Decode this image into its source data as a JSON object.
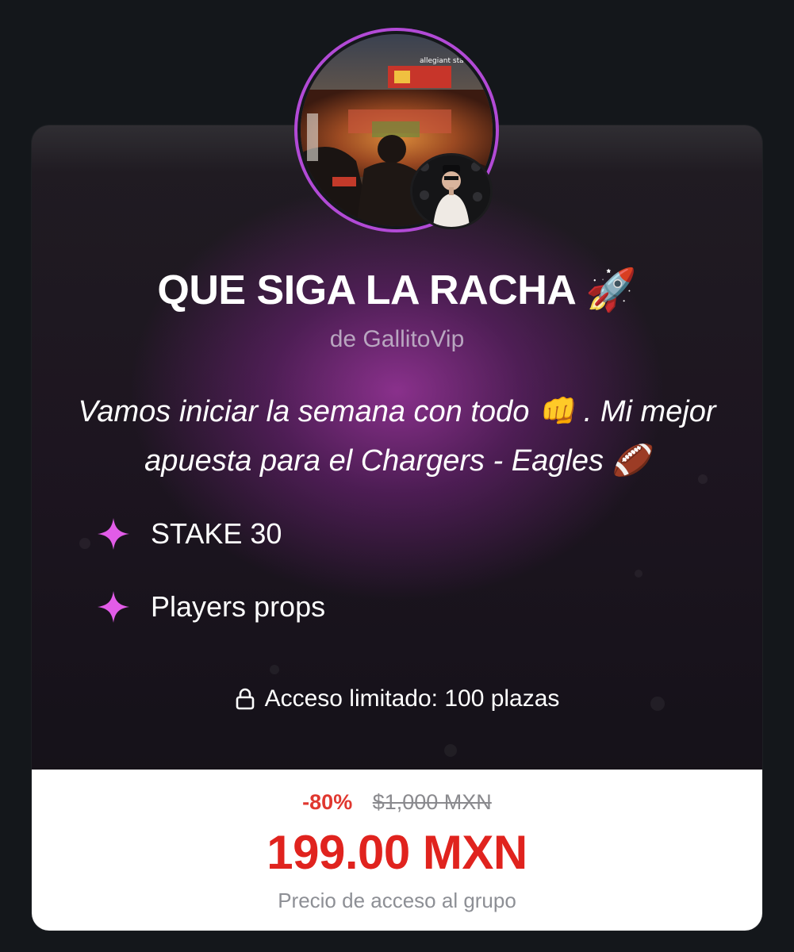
{
  "group": {
    "title": "QUE SIGA LA RACHA 🚀",
    "author": "de GallitoVip",
    "description": "Vamos iniciar la semana con todo 👊 . Mi mejor apuesta para el Chargers - Eagles 🏈",
    "features": [
      {
        "label": "STAKE 30",
        "icon": "sparkle-icon"
      },
      {
        "label": "Players props",
        "icon": "sparkle-icon"
      }
    ],
    "access": "Acceso limitado: 100 plazas"
  },
  "pricing": {
    "discount": "-80%",
    "original_price": "$1,000 MXN",
    "price": "199.00 MXN",
    "caption": "Precio de acceso al grupo"
  },
  "avatar": {
    "stadium_sign": "allegiant stadium"
  },
  "colors": {
    "background": "#14171b",
    "accent_purple": "#b24ad6",
    "sparkle_pink": "#e25ce8",
    "price_red": "#e0231e"
  }
}
